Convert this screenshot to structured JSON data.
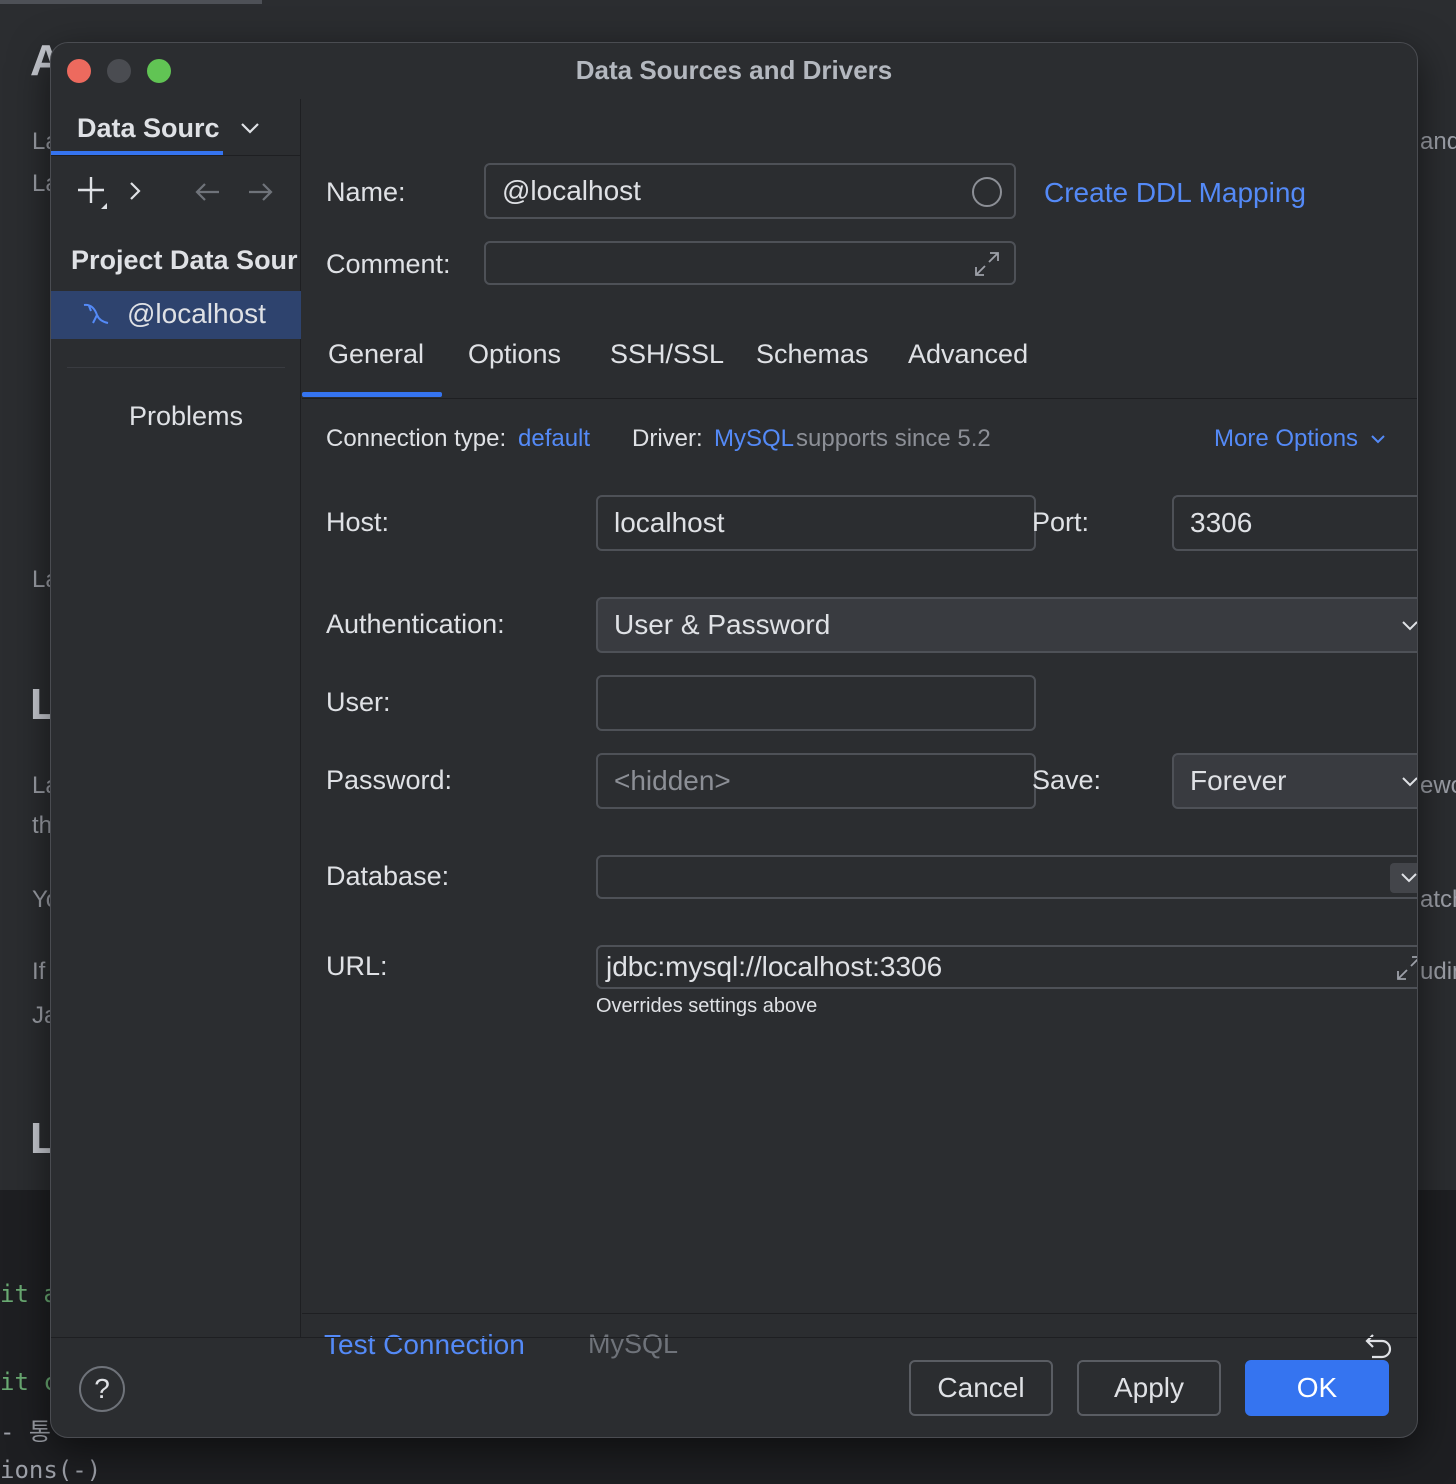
{
  "window": {
    "title": "Data Sources and Drivers"
  },
  "sidebar": {
    "tab_label": "Data Sourc",
    "section_title": "Project Data Sour",
    "items": [
      {
        "label": "@localhost",
        "icon": "mysql-dolphin-icon"
      }
    ],
    "problems_label": "Problems"
  },
  "header": {
    "name_label": "Name:",
    "name_value": "@localhost",
    "comment_label": "Comment:",
    "comment_value": "",
    "ddl_link": "Create DDL Mapping"
  },
  "tabs": [
    {
      "label": "General",
      "active": true
    },
    {
      "label": "Options",
      "active": false
    },
    {
      "label": "SSH/SSL",
      "active": false
    },
    {
      "label": "Schemas",
      "active": false
    },
    {
      "label": "Advanced",
      "active": false
    }
  ],
  "connection": {
    "type_label": "Connection type:",
    "type_value": "default",
    "driver_label": "Driver:",
    "driver_value": "MySQL",
    "driver_note": "supports since 5.2",
    "more_options": "More Options"
  },
  "form": {
    "host_label": "Host:",
    "host_value": "localhost",
    "port_label": "Port:",
    "port_value": "3306",
    "auth_label": "Authentication:",
    "auth_value": "User & Password",
    "user_label": "User:",
    "user_value": "",
    "password_label": "Password:",
    "password_placeholder": "<hidden>",
    "save_label": "Save:",
    "save_value": "Forever",
    "database_label": "Database:",
    "database_value": "",
    "url_label": "URL:",
    "url_value": "jdbc:mysql://localhost:3306",
    "url_hint": "Overrides settings above"
  },
  "bottom": {
    "test_connection": "Test Connection",
    "driver_name": "MySQL"
  },
  "footer": {
    "help": "?",
    "cancel": "Cancel",
    "apply": "Apply",
    "ok": "OK"
  },
  "background": {
    "heading_fragments": [
      "A",
      "L",
      "L"
    ],
    "text_fragments": [
      "La",
      "La",
      "La",
      "La",
      "th",
      "Yo",
      "If",
      "Ja",
      "and",
      "ewo",
      "atch",
      "udin"
    ],
    "code_fragments": [
      "it a",
      "it c",
      "- 통",
      "ions(-)"
    ]
  },
  "colors": {
    "accent": "#3574f0",
    "link": "#548af7",
    "dialog_bg": "#2b2d30",
    "selection": "#2e436e"
  }
}
